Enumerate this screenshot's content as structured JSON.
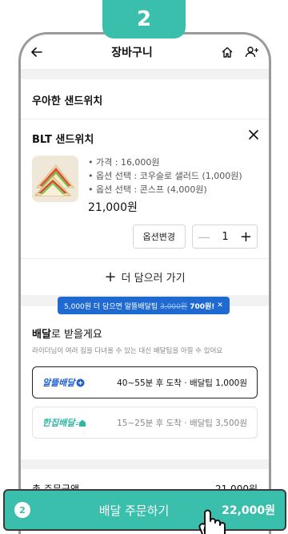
{
  "step_number": "2",
  "appbar": {
    "title": "장바구니",
    "back_icon": "back-arrow-icon",
    "home_icon": "home-icon",
    "profile_icon": "user-plus-icon"
  },
  "store": {
    "name": "우아한 샌드위치"
  },
  "cart_item": {
    "title": "BLT 샌드위치",
    "details": [
      "가격 : 16,000원",
      "옵션 선택 : 코우슬로 샐러드 (1,000원)",
      "옵션 선택 : 콘스프 (4,000원)"
    ],
    "price": "21,000원",
    "option_button": "옵션변경",
    "quantity": "1"
  },
  "add_more": {
    "label": "더 담으러 가기"
  },
  "promo": {
    "prefix": "5,000원 더 담으면 알뜰배달팁",
    "old_fee": "3,000원",
    "new_fee": "700원!",
    "close": "✕"
  },
  "delivery": {
    "title_bold": "배달",
    "title_rest": "로 받을게요",
    "subtitle": "라이더님이 여러 집을 다녀올 수 있는 대신 배달팁을 아낄 수 있어요",
    "options": [
      {
        "brand": "알뜰배달",
        "desc": "40~55분 후 도착 · 배달팁 1,000원",
        "selected": true
      },
      {
        "brand": "한집배달",
        "desc": "15~25분 후 도착 · 배달팁 3,500원",
        "selected": false
      }
    ]
  },
  "summary": {
    "label": "총 주문금액",
    "value": "21,000원"
  },
  "order_bar": {
    "count": "2",
    "label": "배달 주문하기",
    "total": "22,000원"
  },
  "colors": {
    "accent": "#3bbfad",
    "promo": "#1f6ad1",
    "brand_blue": "#1f5fd1"
  }
}
